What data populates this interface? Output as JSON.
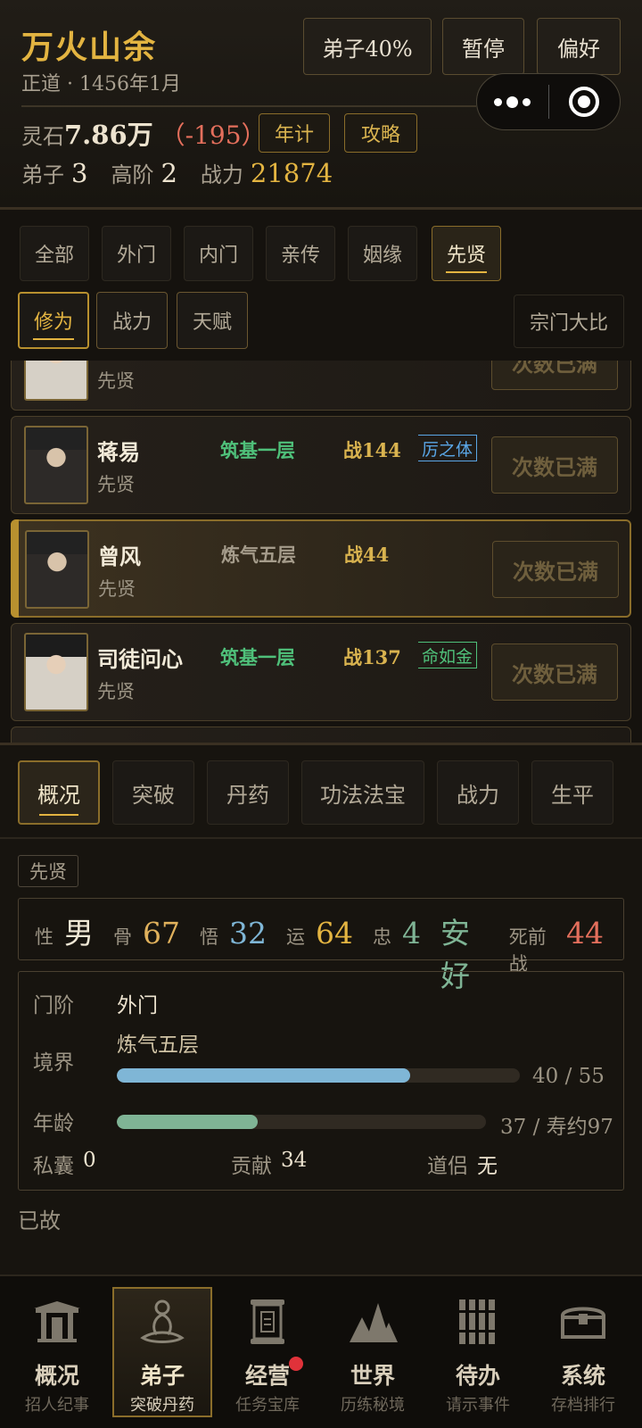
{
  "header": {
    "sect_name": "万火山余",
    "date": "正道 · 1456年1月",
    "buttons": {
      "disciple_rate": "弟子40%",
      "pause": "暂停",
      "preference": "偏好"
    },
    "resource": {
      "label": "灵石",
      "value": "7.86万",
      "delta": "（-195）"
    },
    "resource_buttons": {
      "yearly": "年计",
      "guide": "攻略"
    },
    "stats": {
      "disciples_label": "弟子",
      "disciples": "3",
      "senior_label": "高阶",
      "senior": "2",
      "power_label": "战力",
      "power": "21874"
    }
  },
  "filters": {
    "tabs": [
      "全部",
      "外门",
      "内门",
      "亲传",
      "姻缘",
      "先贤"
    ],
    "active_tab": "先贤",
    "sort": [
      "修为",
      "战力",
      "天赋"
    ],
    "active_sort": "修为",
    "competition": "宗门大比"
  },
  "list": [
    {
      "name": "",
      "tag": "先贤",
      "realm": "",
      "power": "",
      "trait": "",
      "action": "次数已满"
    },
    {
      "name": "蒋易",
      "tag": "先贤",
      "realm": "筑基一层",
      "realm_color": "#4fc07a",
      "power": "战144",
      "trait": "厉之体",
      "trait_color": "#5aa6e6",
      "action": "次数已满"
    },
    {
      "name": "曾风",
      "tag": "先贤",
      "realm": "炼气五层",
      "realm_color": "#a59c8b",
      "power": "战44",
      "trait": "",
      "action": "次数已满"
    },
    {
      "name": "司徒问心",
      "tag": "先贤",
      "realm": "筑基一层",
      "realm_color": "#4fc07a",
      "power": "战137",
      "trait": "命如金",
      "trait_color": "#4fc07a",
      "action": "次数已满"
    }
  ],
  "detail": {
    "tabs": [
      "概况",
      "突破",
      "丹药",
      "功法法宝",
      "战力",
      "生平"
    ],
    "active_tab": "概况",
    "badge": "先贤",
    "attrs": {
      "gender_label": "性",
      "gender": "男",
      "bone_label": "骨",
      "bone": "67",
      "insight_label": "悟",
      "insight": "32",
      "luck_label": "运",
      "luck": "64",
      "loyalty_label": "忠",
      "loyalty": "4",
      "state": "安好",
      "death_power_label": "死前战",
      "death_power": "44"
    },
    "rank_label": "门阶",
    "rank": "外门",
    "realm_label": "境界",
    "realm": "炼气五层",
    "realm_progress": {
      "current": 40,
      "max": 55,
      "text": "40 / 55"
    },
    "age_label": "年龄",
    "age_progress": {
      "current": 37,
      "max": 97,
      "text": "37 / 寿约97"
    },
    "purse_label": "私囊",
    "purse": "0",
    "contrib_label": "贡献",
    "contrib": "34",
    "partner_label": "道侣",
    "partner": "无",
    "status": "已故"
  },
  "nav": [
    {
      "title": "概况",
      "sub": "招人纪事",
      "icon": "gate-icon"
    },
    {
      "title": "弟子",
      "sub": "突破丹药",
      "icon": "meditation-icon"
    },
    {
      "title": "经营",
      "sub": "任务宝库",
      "icon": "scroll-icon"
    },
    {
      "title": "世界",
      "sub": "历练秘境",
      "icon": "mountain-icon"
    },
    {
      "title": "待办",
      "sub": "请示事件",
      "icon": "bamboo-slips-icon"
    },
    {
      "title": "系统",
      "sub": "存档排行",
      "icon": "chest-icon"
    }
  ],
  "nav_active": "弟子",
  "colors": {
    "gold": "#e3b441",
    "red_delta": "#e46f5c",
    "green": "#4fc07a",
    "blue": "#5aa6e6",
    "realm_bar": "#7fb6d6",
    "age_bar": "#7fb495",
    "notify": "#e0323a"
  }
}
